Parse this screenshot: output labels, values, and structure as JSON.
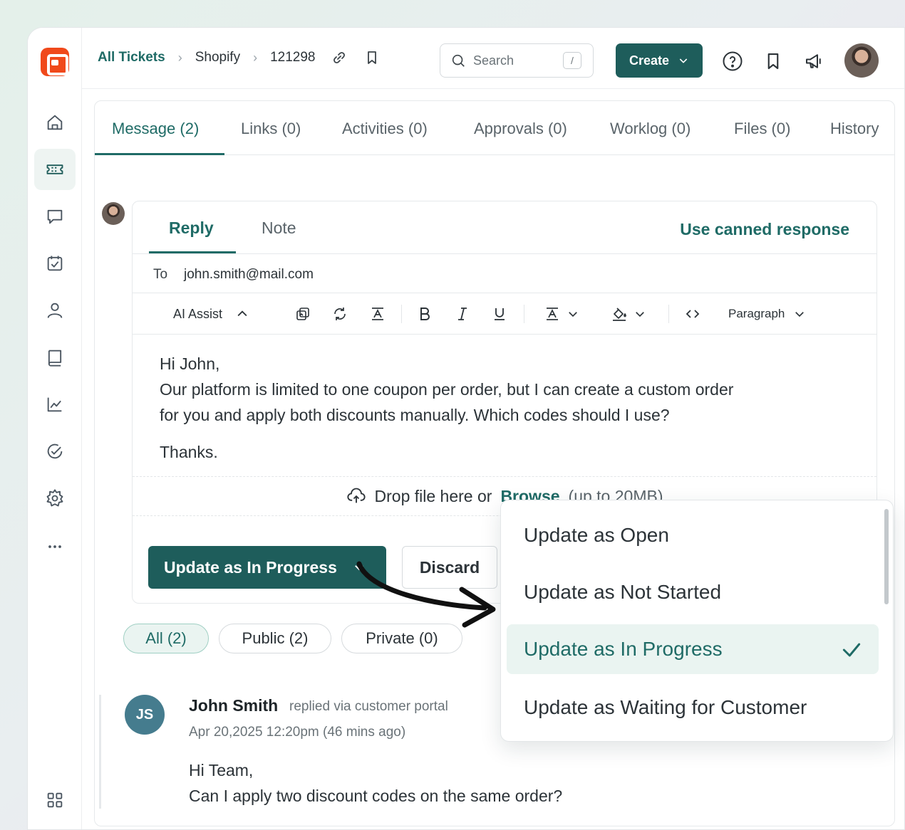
{
  "breadcrumbs": {
    "root": "All Tickets",
    "org": "Shopify",
    "ticket": "121298"
  },
  "search": {
    "placeholder": "Search",
    "shortcut": "/"
  },
  "create_label": "Create",
  "tabs": [
    "Message (2)",
    "Links (0)",
    "Activities (0)",
    "Approvals (0)",
    "Worklog (0)",
    "Files (0)",
    "History"
  ],
  "composer": {
    "tabs": [
      "Reply",
      "Note"
    ],
    "canned": "Use canned response",
    "to_label": "To",
    "to_value": "john.smith@mail.com",
    "toolbar": {
      "ai_assist": "AI Assist",
      "paragraph": "Paragraph"
    },
    "body": {
      "greeting": "Hi John,",
      "line1": "Our platform is limited to one coupon per order, but I can create a custom order",
      "line2": "for you and apply both discounts manually. Which codes should I use?",
      "closing": "Thanks."
    },
    "drop": {
      "text": "Drop file here or",
      "browse": "Browse",
      "limit": "(up to 20MB)"
    },
    "primary_button": "Update as In Progress",
    "discard_button": "Discard"
  },
  "filters": [
    "All (2)",
    "Public (2)",
    "Private (0)"
  ],
  "thread": {
    "initials": "JS",
    "author": "John Smith",
    "via": "replied via customer portal",
    "timestamp": "Apr 20,2025 12:20pm (46 mins ago)",
    "line1": "Hi Team,",
    "line2": "Can I apply two discount codes on the same order?"
  },
  "status_menu": {
    "items": [
      "Update as Open",
      "Update as Not Started",
      "Update as In Progress",
      "Update as Waiting for Customer"
    ],
    "selected_index": 2
  },
  "colors": {
    "brand": "#f0491b",
    "accent": "#1e5d5b",
    "link": "#1f6b66"
  }
}
